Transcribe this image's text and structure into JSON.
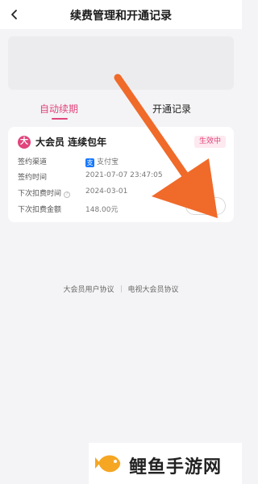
{
  "header": {
    "title": "续费管理和开通记录"
  },
  "tabs": [
    {
      "label": "自动续期",
      "active": true
    },
    {
      "label": "开通记录",
      "active": false
    }
  ],
  "subscription": {
    "logo_char": "大",
    "title": "大会员 连续包年",
    "status": "生效中",
    "rows": [
      {
        "label": "签约渠道",
        "value": "支付宝"
      },
      {
        "label": "签约时间",
        "value": "2021-07-07 23:47:05"
      },
      {
        "label": "下次扣费时间",
        "value": "2024-03-01"
      },
      {
        "label": "下次扣费金额",
        "value": "148.00元"
      }
    ],
    "cancel_label": "解约"
  },
  "footer": {
    "links": [
      "大会员用户协议",
      "电视大会员协议"
    ]
  },
  "watermark": {
    "text": "鲤鱼手游网"
  },
  "colors": {
    "accent": "#e0457b",
    "arrow": "#f06a2a",
    "alipay": "#1677ff",
    "background": "#f4f4f6"
  }
}
